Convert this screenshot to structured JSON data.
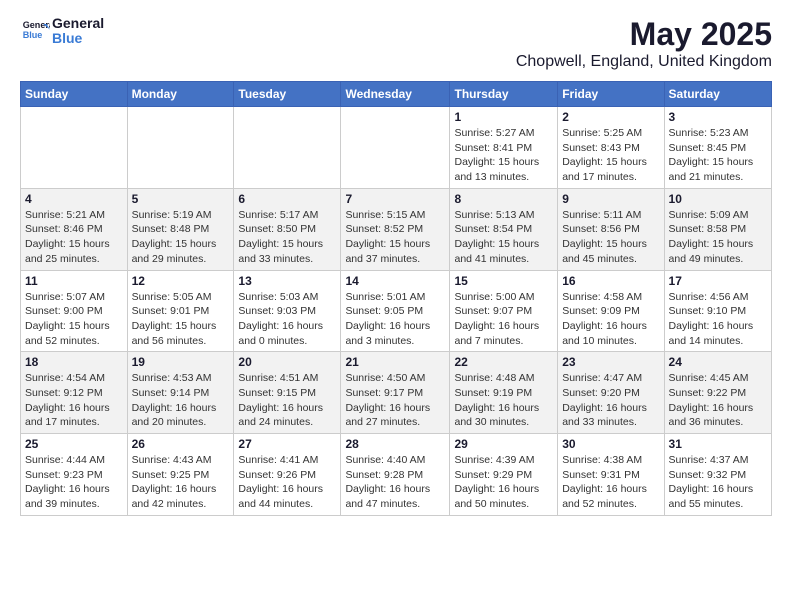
{
  "header": {
    "logo_general": "General",
    "logo_blue": "Blue",
    "title": "May 2025",
    "subtitle": "Chopwell, England, United Kingdom"
  },
  "calendar": {
    "weekdays": [
      "Sunday",
      "Monday",
      "Tuesday",
      "Wednesday",
      "Thursday",
      "Friday",
      "Saturday"
    ],
    "weeks": [
      [
        {
          "day": "",
          "content": ""
        },
        {
          "day": "",
          "content": ""
        },
        {
          "day": "",
          "content": ""
        },
        {
          "day": "",
          "content": ""
        },
        {
          "day": "1",
          "content": "Sunrise: 5:27 AM\nSunset: 8:41 PM\nDaylight: 15 hours\nand 13 minutes."
        },
        {
          "day": "2",
          "content": "Sunrise: 5:25 AM\nSunset: 8:43 PM\nDaylight: 15 hours\nand 17 minutes."
        },
        {
          "day": "3",
          "content": "Sunrise: 5:23 AM\nSunset: 8:45 PM\nDaylight: 15 hours\nand 21 minutes."
        }
      ],
      [
        {
          "day": "4",
          "content": "Sunrise: 5:21 AM\nSunset: 8:46 PM\nDaylight: 15 hours\nand 25 minutes."
        },
        {
          "day": "5",
          "content": "Sunrise: 5:19 AM\nSunset: 8:48 PM\nDaylight: 15 hours\nand 29 minutes."
        },
        {
          "day": "6",
          "content": "Sunrise: 5:17 AM\nSunset: 8:50 PM\nDaylight: 15 hours\nand 33 minutes."
        },
        {
          "day": "7",
          "content": "Sunrise: 5:15 AM\nSunset: 8:52 PM\nDaylight: 15 hours\nand 37 minutes."
        },
        {
          "day": "8",
          "content": "Sunrise: 5:13 AM\nSunset: 8:54 PM\nDaylight: 15 hours\nand 41 minutes."
        },
        {
          "day": "9",
          "content": "Sunrise: 5:11 AM\nSunset: 8:56 PM\nDaylight: 15 hours\nand 45 minutes."
        },
        {
          "day": "10",
          "content": "Sunrise: 5:09 AM\nSunset: 8:58 PM\nDaylight: 15 hours\nand 49 minutes."
        }
      ],
      [
        {
          "day": "11",
          "content": "Sunrise: 5:07 AM\nSunset: 9:00 PM\nDaylight: 15 hours\nand 52 minutes."
        },
        {
          "day": "12",
          "content": "Sunrise: 5:05 AM\nSunset: 9:01 PM\nDaylight: 15 hours\nand 56 minutes."
        },
        {
          "day": "13",
          "content": "Sunrise: 5:03 AM\nSunset: 9:03 PM\nDaylight: 16 hours\nand 0 minutes."
        },
        {
          "day": "14",
          "content": "Sunrise: 5:01 AM\nSunset: 9:05 PM\nDaylight: 16 hours\nand 3 minutes."
        },
        {
          "day": "15",
          "content": "Sunrise: 5:00 AM\nSunset: 9:07 PM\nDaylight: 16 hours\nand 7 minutes."
        },
        {
          "day": "16",
          "content": "Sunrise: 4:58 AM\nSunset: 9:09 PM\nDaylight: 16 hours\nand 10 minutes."
        },
        {
          "day": "17",
          "content": "Sunrise: 4:56 AM\nSunset: 9:10 PM\nDaylight: 16 hours\nand 14 minutes."
        }
      ],
      [
        {
          "day": "18",
          "content": "Sunrise: 4:54 AM\nSunset: 9:12 PM\nDaylight: 16 hours\nand 17 minutes."
        },
        {
          "day": "19",
          "content": "Sunrise: 4:53 AM\nSunset: 9:14 PM\nDaylight: 16 hours\nand 20 minutes."
        },
        {
          "day": "20",
          "content": "Sunrise: 4:51 AM\nSunset: 9:15 PM\nDaylight: 16 hours\nand 24 minutes."
        },
        {
          "day": "21",
          "content": "Sunrise: 4:50 AM\nSunset: 9:17 PM\nDaylight: 16 hours\nand 27 minutes."
        },
        {
          "day": "22",
          "content": "Sunrise: 4:48 AM\nSunset: 9:19 PM\nDaylight: 16 hours\nand 30 minutes."
        },
        {
          "day": "23",
          "content": "Sunrise: 4:47 AM\nSunset: 9:20 PM\nDaylight: 16 hours\nand 33 minutes."
        },
        {
          "day": "24",
          "content": "Sunrise: 4:45 AM\nSunset: 9:22 PM\nDaylight: 16 hours\nand 36 minutes."
        }
      ],
      [
        {
          "day": "25",
          "content": "Sunrise: 4:44 AM\nSunset: 9:23 PM\nDaylight: 16 hours\nand 39 minutes."
        },
        {
          "day": "26",
          "content": "Sunrise: 4:43 AM\nSunset: 9:25 PM\nDaylight: 16 hours\nand 42 minutes."
        },
        {
          "day": "27",
          "content": "Sunrise: 4:41 AM\nSunset: 9:26 PM\nDaylight: 16 hours\nand 44 minutes."
        },
        {
          "day": "28",
          "content": "Sunrise: 4:40 AM\nSunset: 9:28 PM\nDaylight: 16 hours\nand 47 minutes."
        },
        {
          "day": "29",
          "content": "Sunrise: 4:39 AM\nSunset: 9:29 PM\nDaylight: 16 hours\nand 50 minutes."
        },
        {
          "day": "30",
          "content": "Sunrise: 4:38 AM\nSunset: 9:31 PM\nDaylight: 16 hours\nand 52 minutes."
        },
        {
          "day": "31",
          "content": "Sunrise: 4:37 AM\nSunset: 9:32 PM\nDaylight: 16 hours\nand 55 minutes."
        }
      ]
    ]
  }
}
